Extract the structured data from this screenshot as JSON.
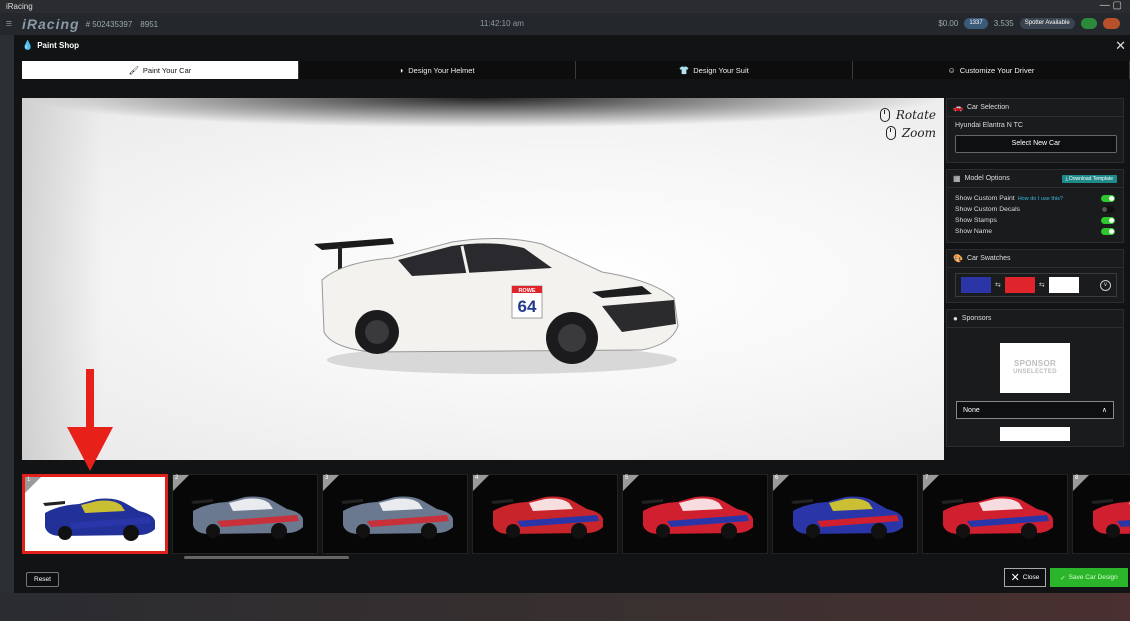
{
  "app": {
    "title": "iRacing",
    "window_controls": "—  ▢"
  },
  "topbar": {
    "logo": "iRacing",
    "member_id": "# 502435397",
    "irating": "8951",
    "clock": "11:42:10 am",
    "right_items": [
      "$0.00",
      "1337",
      "3.535",
      "Spotter Available"
    ]
  },
  "modal": {
    "title": "Paint Shop",
    "close_symbol": "✕",
    "tabs": [
      {
        "label": "Paint Your Car",
        "icon": "spray-paint-icon",
        "glyph": "🖌"
      },
      {
        "label": "Design Your Helmet",
        "icon": "helmet-icon",
        "glyph": "◗"
      },
      {
        "label": "Design Your Suit",
        "icon": "suit-icon",
        "glyph": "👕"
      },
      {
        "label": "Customize Your Driver",
        "icon": "driver-icon",
        "glyph": "☺"
      }
    ]
  },
  "viewport": {
    "rotate_label": "Rotate",
    "zoom_label": "Zoom",
    "car_number": "64",
    "car_sponsor": "ROWE"
  },
  "panel": {
    "car_selection": {
      "header": "Car Selection",
      "car_name": "Hyundai Elantra N TC",
      "button": "Select New Car"
    },
    "model_options": {
      "header": "Model Options",
      "template_button": "⤓ Download Template",
      "help_text": "How do I use this?",
      "options": [
        {
          "label": "Show Custom Paint",
          "on": true
        },
        {
          "label": "Show Custom Decals",
          "on": false
        },
        {
          "label": "Show Stamps",
          "on": true
        },
        {
          "label": "Show Name",
          "on": true
        }
      ]
    },
    "swatches": {
      "header": "Car Swatches",
      "colors": [
        "#2a36a8",
        "#e0242c",
        "#ffffff"
      ],
      "swap_symbol": "⇆"
    },
    "sponsors": {
      "header": "Sponsors",
      "placeholder_line1": "SPONSOR",
      "placeholder_line2": "UNSELECTED",
      "select_value": "None",
      "select_chevron": "∧"
    }
  },
  "thumbnails": [
    {
      "num": "1",
      "body": "#22309a",
      "accent": "#2a36a8",
      "stripe": "#e8d820"
    },
    {
      "num": "2",
      "body": "#6a7890",
      "accent": "#c8303a",
      "stripe": "#ffffff"
    },
    {
      "num": "3",
      "body": "#6a7890",
      "accent": "#c8303a",
      "stripe": "#ffffff"
    },
    {
      "num": "4",
      "body": "#c8242c",
      "accent": "#2a36a8",
      "stripe": "#ffffff"
    },
    {
      "num": "5",
      "body": "#d02030",
      "accent": "#2a36a8",
      "stripe": "#ffffff"
    },
    {
      "num": "6",
      "body": "#2a36a8",
      "accent": "#d02030",
      "stripe": "#e8d820"
    },
    {
      "num": "7",
      "body": "#d02030",
      "accent": "#2a36a8",
      "stripe": "#ffffff"
    },
    {
      "num": "8",
      "body": "#d02030",
      "accent": "#2a36a8",
      "stripe": "#ffffff"
    }
  ],
  "footer": {
    "reset": "Reset",
    "close": "Close",
    "close_symbol": "✕",
    "save": "Save Car Design",
    "save_symbol": "✓"
  },
  "colors": {
    "accent_green": "#2bb52b",
    "highlight_red": "#e0201a",
    "toggle_on": "#2ec72e"
  }
}
